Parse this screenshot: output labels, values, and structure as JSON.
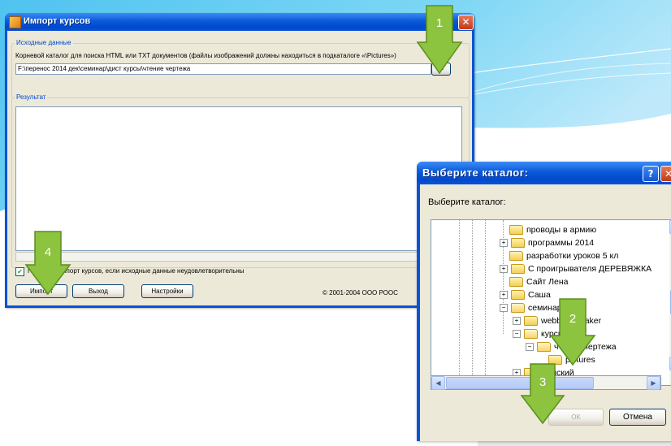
{
  "main_window": {
    "title": "Импорт курсов",
    "source_group_label": "Исходные данные",
    "root_hint": "Корневой каталог для поиска HTML или TXT документов (файлы изображений должны находиться в подкаталоге «\\Pictures»)",
    "path_value": "F:\\перенос 2014 дек\\семинар\\дист курсы\\чтение чертежа",
    "browse_label": "...",
    "result_group_label": "Результат",
    "abort_checkbox_label": "Прервать импорт курсов, если исходные данные неудовлетворительны",
    "import_button": "Импорт",
    "exit_button": "Выход",
    "settings_button": "Настройки",
    "copyright": "© 2001-2004  ООО РООС"
  },
  "dialog": {
    "title": "Выберите каталог:",
    "prompt": "Выберите каталог:",
    "help_glyph": "?",
    "close_glyph": "✕",
    "tree_items": [
      {
        "label": "проводы в армию",
        "expander": ""
      },
      {
        "label": "программы 2014",
        "expander": "+"
      },
      {
        "label": "разработки уроков 5 кл",
        "expander": ""
      },
      {
        "label": "С проигрывателя ДЕРЕВЯЖКА",
        "expander": "+"
      },
      {
        "label": "Сайт Лена",
        "expander": ""
      },
      {
        "label": "Саша",
        "expander": "+"
      },
      {
        "label": "семинар",
        "expander": "−"
      },
      {
        "label": "webbook maker",
        "expander": "+"
      },
      {
        "label": "курсы",
        "expander": "−"
      },
      {
        "label": "чтение чертежа",
        "expander": "−"
      },
      {
        "label": "pictures",
        "expander": ""
      },
      {
        "label": "Тимский",
        "expander": "+"
      }
    ],
    "ok_button": "OK",
    "cancel_button": "Отмена"
  },
  "steps": [
    "1",
    "2",
    "3",
    "4"
  ],
  "colors": {
    "step_marker": "#8cc33f",
    "title_bar": "#0a52d6",
    "window_face": "#ece9d8"
  }
}
